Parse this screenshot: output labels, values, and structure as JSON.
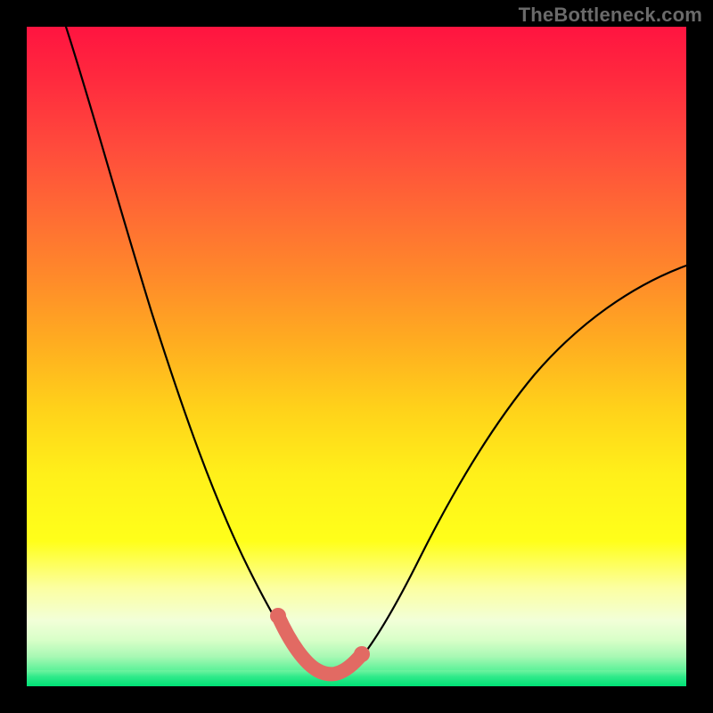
{
  "watermark": "TheBottleneck.com",
  "chart_data": {
    "type": "line",
    "title": "",
    "xlabel": "",
    "ylabel": "",
    "xlim": [
      0,
      100
    ],
    "ylim": [
      0,
      100
    ],
    "grid": false,
    "background_gradient": {
      "direction": "vertical",
      "stops": [
        {
          "pos": 0.0,
          "color": "#ff1440"
        },
        {
          "pos": 0.22,
          "color": "#ff5a3a"
        },
        {
          "pos": 0.42,
          "color": "#ff9a28"
        },
        {
          "pos": 0.6,
          "color": "#ffd21a"
        },
        {
          "pos": 0.78,
          "color": "#ffff1a"
        },
        {
          "pos": 0.88,
          "color": "#f5ffb0"
        },
        {
          "pos": 0.93,
          "color": "#c8ffb4"
        },
        {
          "pos": 0.97,
          "color": "#60f28c"
        },
        {
          "pos": 1.0,
          "color": "#00e57a"
        }
      ]
    },
    "series": [
      {
        "name": "bottleneck-curve",
        "color": "#000000",
        "x": [
          6,
          10,
          14,
          18,
          22,
          26,
          30,
          34,
          38,
          40,
          42,
          44,
          46,
          48,
          50,
          54,
          58,
          62,
          66,
          72,
          80,
          90,
          100
        ],
        "y": [
          100,
          86,
          73,
          62,
          52,
          43,
          35,
          27,
          17,
          11,
          6,
          3,
          1,
          1,
          2,
          6,
          12,
          20,
          28,
          38,
          48,
          57,
          62
        ]
      }
    ],
    "highlight_region": {
      "name": "optimal-range",
      "color": "#e26a63",
      "x": [
        38,
        40,
        42,
        44,
        46,
        48,
        50
      ],
      "y": [
        11,
        6,
        3,
        1,
        1,
        2,
        4
      ],
      "endpoints": [
        {
          "x": 38,
          "y": 11
        },
        {
          "x": 50,
          "y": 4
        }
      ]
    },
    "annotations": []
  }
}
